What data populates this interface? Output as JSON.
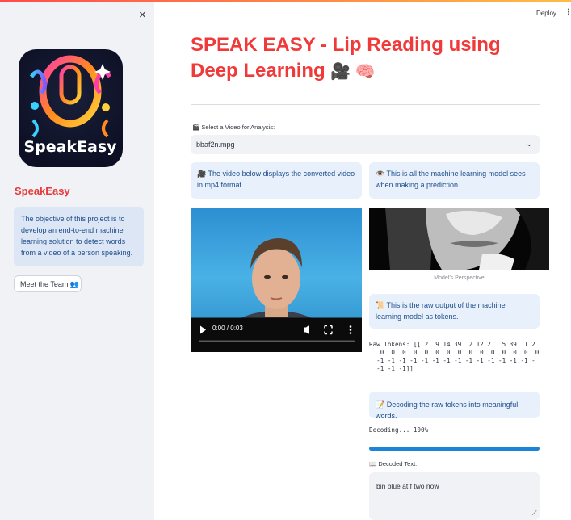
{
  "app": {
    "deploy_label": "Deploy",
    "menu_icon": "⋮"
  },
  "sidebar": {
    "close_icon": "×",
    "logo_text": "SpeakEasy",
    "title": "SpeakEasy",
    "info": "The objective of this project is to develop an end-to-end machine learning solution to detect words from a video of a person speaking.",
    "team_button": "Meet the Team 👥"
  },
  "main": {
    "title": "SPEAK EASY - Lip Reading using Deep Learning",
    "title_emojis": "🎥 🧠",
    "select_label": "🎬 Select a Video for Analysis:",
    "select_value": "bbaf2n.mpg",
    "left_info": "🎥 The video below displays the converted video in mp4 format.",
    "right_info": "👁️ This is all the machine learning model sees when making a prediction.",
    "video": {
      "time": "0:00 / 0:03"
    },
    "mouth_caption": "Model's Perspective",
    "tokens_info": "📜 This is the raw output of the machine learning model as tokens.",
    "raw_tokens": "Raw Tokens: [[ 2  9 14 39  2 12 21  5 39  1 2\n   0  0  0  0  0  0  0  0  0  0  0  0  0  0  0\n  -1 -1 -1 -1 -1 -1 -1 -1 -1 -1 -1 -1 -1 -1 -\n  -1 -1 -1]]",
    "decode_info": "📝 Decoding the raw tokens into meaningful words.",
    "decoding_status": "Decoding... 100%",
    "progress": 1.0,
    "decoded_label": "📖 Decoded Text:",
    "decoded_text": "bin blue at f two now"
  }
}
